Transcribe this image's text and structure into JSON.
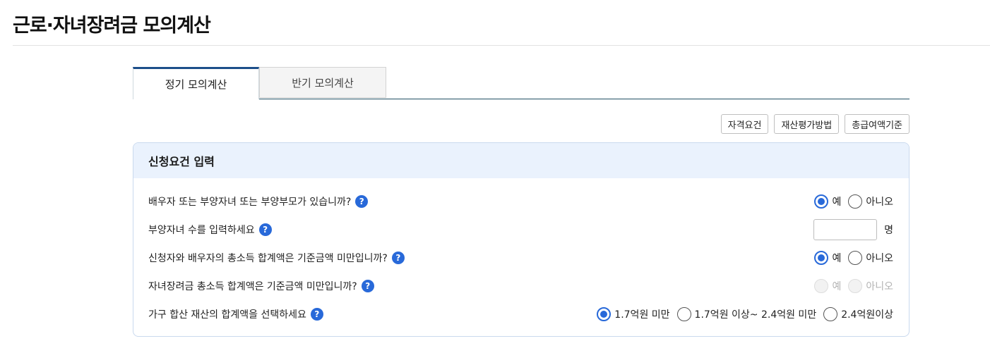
{
  "page_title": "근로·자녀장려금 모의계산",
  "tabs": [
    {
      "label": "정기 모의계산",
      "active": true
    },
    {
      "label": "반기 모의계산",
      "active": false
    }
  ],
  "doc_buttons": [
    "자격요건",
    "재산평가방법",
    "총급여액기준"
  ],
  "panel": {
    "title": "신청요건 입력",
    "questions": [
      {
        "label": "배우자 또는 부양자녀 또는 부양부모가 있습니까?",
        "options": [
          "예",
          "아니오"
        ],
        "selected": "예"
      },
      {
        "label": "부양자녀 수를 입력하세요",
        "input_value": "",
        "unit": "명"
      },
      {
        "label": "신청자와 배우자의 총소득 합계액은 기준금액 미만입니까?",
        "options": [
          "예",
          "아니오"
        ],
        "selected": "예"
      },
      {
        "label": "자녀장려금 총소득 합계액은 기준금액 미만입니까?",
        "options": [
          "예",
          "아니오"
        ],
        "selected": null,
        "disabled": true
      },
      {
        "label": "가구 합산 재산의 합계액을 선택하세요",
        "options": [
          "1.7억원 미만",
          "1.7억원 이상~ 2.4억원 미만",
          "2.4억원이상"
        ],
        "selected": "1.7억원 미만"
      }
    ]
  },
  "help_icon_glyph": "?",
  "colors": {
    "accent": "#2869d9",
    "tab_active_border": "#1d4f8a",
    "panel_header_bg": "#eaf2fd"
  }
}
